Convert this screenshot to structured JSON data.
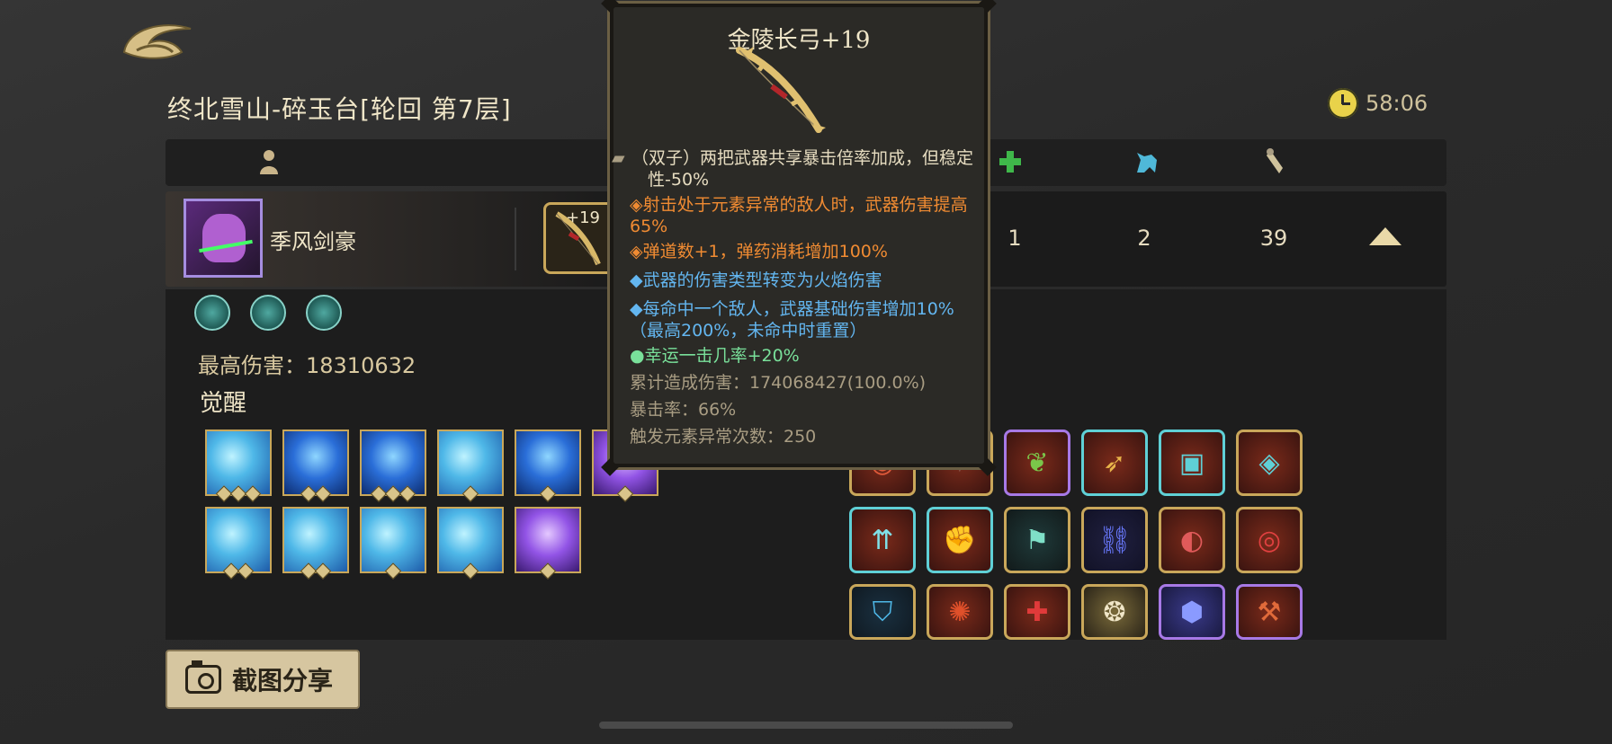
{
  "header": {
    "title": "终北雪山-碎玉台[轮回 第7层]",
    "timer": "58:06"
  },
  "character": {
    "name": "季风剑豪",
    "weapon_level": "+19",
    "stats": [
      "1",
      "2",
      "39"
    ]
  },
  "panel": {
    "max_damage_label": "最高伤害：18310632",
    "awaken_label": "觉醒"
  },
  "tooltip": {
    "title": "金陵长弓+19",
    "lines": [
      {
        "text": "（双子）两把武器共享暴击倍率加成，但稳定性-50%",
        "color": "#e6dcc0"
      },
      {
        "text": "◈射击处于元素异常的敌人时，武器伤害提高65%",
        "color": "#f08b32"
      },
      {
        "text": "◈弹道数+1，弹药消耗增加100%",
        "color": "#f08b32"
      },
      {
        "text": "◆武器的伤害类型转变为火焰伤害",
        "color": "#63b6f0"
      },
      {
        "text": "◆每命中一个敌人，武器基础伤害增加10%（最高200%，未命中时重置）",
        "color": "#63b6f0"
      },
      {
        "text": "●幸运一击几率+20%",
        "color": "#79e09a"
      },
      {
        "text": "累计造成伤害：174068427(100.0%)",
        "color": "#a99d83"
      },
      {
        "text": "暴击率：66%",
        "color": "#a99d83"
      },
      {
        "text": "触发元素异常次数：250",
        "color": "#a99d83"
      }
    ]
  },
  "share_button": {
    "label": "截图分享"
  },
  "tabs": [
    {
      "icon": "person-icon"
    },
    {
      "icon": "plus-icon"
    },
    {
      "icon": "beast-icon"
    },
    {
      "icon": "scroll-icon"
    }
  ],
  "colors": {
    "accent_gold": "#c9a75a",
    "text_orange": "#f08b32",
    "text_blue": "#63b6f0",
    "text_green": "#79e09a"
  }
}
